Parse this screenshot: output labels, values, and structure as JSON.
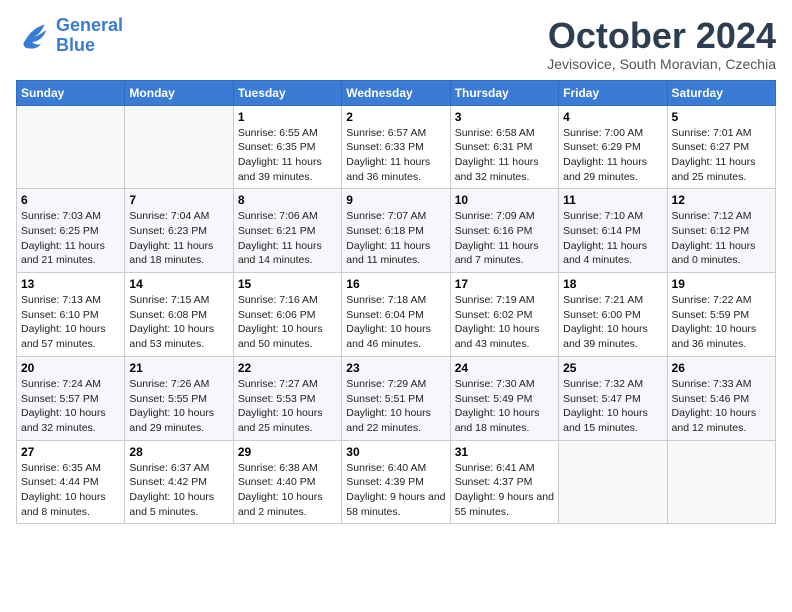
{
  "header": {
    "logo_line1": "General",
    "logo_line2": "Blue",
    "month_title": "October 2024",
    "location": "Jevisovice, South Moravian, Czechia"
  },
  "weekdays": [
    "Sunday",
    "Monday",
    "Tuesday",
    "Wednesday",
    "Thursday",
    "Friday",
    "Saturday"
  ],
  "weeks": [
    [
      {
        "day": "",
        "info": ""
      },
      {
        "day": "",
        "info": ""
      },
      {
        "day": "1",
        "info": "Sunrise: 6:55 AM\nSunset: 6:35 PM\nDaylight: 11 hours and 39 minutes."
      },
      {
        "day": "2",
        "info": "Sunrise: 6:57 AM\nSunset: 6:33 PM\nDaylight: 11 hours and 36 minutes."
      },
      {
        "day": "3",
        "info": "Sunrise: 6:58 AM\nSunset: 6:31 PM\nDaylight: 11 hours and 32 minutes."
      },
      {
        "day": "4",
        "info": "Sunrise: 7:00 AM\nSunset: 6:29 PM\nDaylight: 11 hours and 29 minutes."
      },
      {
        "day": "5",
        "info": "Sunrise: 7:01 AM\nSunset: 6:27 PM\nDaylight: 11 hours and 25 minutes."
      }
    ],
    [
      {
        "day": "6",
        "info": "Sunrise: 7:03 AM\nSunset: 6:25 PM\nDaylight: 11 hours and 21 minutes."
      },
      {
        "day": "7",
        "info": "Sunrise: 7:04 AM\nSunset: 6:23 PM\nDaylight: 11 hours and 18 minutes."
      },
      {
        "day": "8",
        "info": "Sunrise: 7:06 AM\nSunset: 6:21 PM\nDaylight: 11 hours and 14 minutes."
      },
      {
        "day": "9",
        "info": "Sunrise: 7:07 AM\nSunset: 6:18 PM\nDaylight: 11 hours and 11 minutes."
      },
      {
        "day": "10",
        "info": "Sunrise: 7:09 AM\nSunset: 6:16 PM\nDaylight: 11 hours and 7 minutes."
      },
      {
        "day": "11",
        "info": "Sunrise: 7:10 AM\nSunset: 6:14 PM\nDaylight: 11 hours and 4 minutes."
      },
      {
        "day": "12",
        "info": "Sunrise: 7:12 AM\nSunset: 6:12 PM\nDaylight: 11 hours and 0 minutes."
      }
    ],
    [
      {
        "day": "13",
        "info": "Sunrise: 7:13 AM\nSunset: 6:10 PM\nDaylight: 10 hours and 57 minutes."
      },
      {
        "day": "14",
        "info": "Sunrise: 7:15 AM\nSunset: 6:08 PM\nDaylight: 10 hours and 53 minutes."
      },
      {
        "day": "15",
        "info": "Sunrise: 7:16 AM\nSunset: 6:06 PM\nDaylight: 10 hours and 50 minutes."
      },
      {
        "day": "16",
        "info": "Sunrise: 7:18 AM\nSunset: 6:04 PM\nDaylight: 10 hours and 46 minutes."
      },
      {
        "day": "17",
        "info": "Sunrise: 7:19 AM\nSunset: 6:02 PM\nDaylight: 10 hours and 43 minutes."
      },
      {
        "day": "18",
        "info": "Sunrise: 7:21 AM\nSunset: 6:00 PM\nDaylight: 10 hours and 39 minutes."
      },
      {
        "day": "19",
        "info": "Sunrise: 7:22 AM\nSunset: 5:59 PM\nDaylight: 10 hours and 36 minutes."
      }
    ],
    [
      {
        "day": "20",
        "info": "Sunrise: 7:24 AM\nSunset: 5:57 PM\nDaylight: 10 hours and 32 minutes."
      },
      {
        "day": "21",
        "info": "Sunrise: 7:26 AM\nSunset: 5:55 PM\nDaylight: 10 hours and 29 minutes."
      },
      {
        "day": "22",
        "info": "Sunrise: 7:27 AM\nSunset: 5:53 PM\nDaylight: 10 hours and 25 minutes."
      },
      {
        "day": "23",
        "info": "Sunrise: 7:29 AM\nSunset: 5:51 PM\nDaylight: 10 hours and 22 minutes."
      },
      {
        "day": "24",
        "info": "Sunrise: 7:30 AM\nSunset: 5:49 PM\nDaylight: 10 hours and 18 minutes."
      },
      {
        "day": "25",
        "info": "Sunrise: 7:32 AM\nSunset: 5:47 PM\nDaylight: 10 hours and 15 minutes."
      },
      {
        "day": "26",
        "info": "Sunrise: 7:33 AM\nSunset: 5:46 PM\nDaylight: 10 hours and 12 minutes."
      }
    ],
    [
      {
        "day": "27",
        "info": "Sunrise: 6:35 AM\nSunset: 4:44 PM\nDaylight: 10 hours and 8 minutes."
      },
      {
        "day": "28",
        "info": "Sunrise: 6:37 AM\nSunset: 4:42 PM\nDaylight: 10 hours and 5 minutes."
      },
      {
        "day": "29",
        "info": "Sunrise: 6:38 AM\nSunset: 4:40 PM\nDaylight: 10 hours and 2 minutes."
      },
      {
        "day": "30",
        "info": "Sunrise: 6:40 AM\nSunset: 4:39 PM\nDaylight: 9 hours and 58 minutes."
      },
      {
        "day": "31",
        "info": "Sunrise: 6:41 AM\nSunset: 4:37 PM\nDaylight: 9 hours and 55 minutes."
      },
      {
        "day": "",
        "info": ""
      },
      {
        "day": "",
        "info": ""
      }
    ]
  ]
}
